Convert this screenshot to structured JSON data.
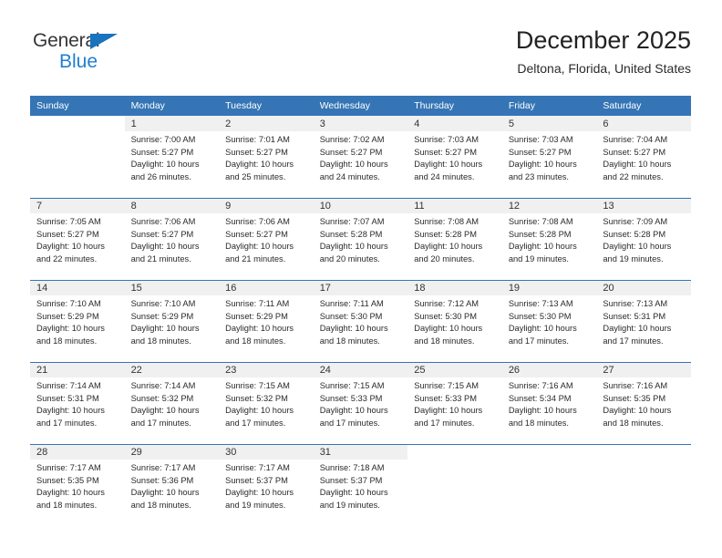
{
  "brand": {
    "name_top": "General",
    "name_bottom": "Blue",
    "triangle_color": "#1973bd",
    "text_color": "#363636",
    "blue_color": "#1f7fd1"
  },
  "header": {
    "title": "December 2025",
    "subtitle": "Deltona, Florida, United States"
  },
  "theme": {
    "header_blue": "#3575b5",
    "daynum_background": "#f0f0f0",
    "row_separator": "#3575b5"
  },
  "calendar": {
    "weekday_headers": [
      "Sunday",
      "Monday",
      "Tuesday",
      "Wednesday",
      "Thursday",
      "Friday",
      "Saturday"
    ],
    "weeks": [
      [
        {
          "day": "",
          "sunrise": "",
          "sunset": "",
          "daylight_a": "",
          "daylight_b": ""
        },
        {
          "day": "1",
          "sunrise": "Sunrise: 7:00 AM",
          "sunset": "Sunset: 5:27 PM",
          "daylight_a": "Daylight: 10 hours",
          "daylight_b": "and 26 minutes."
        },
        {
          "day": "2",
          "sunrise": "Sunrise: 7:01 AM",
          "sunset": "Sunset: 5:27 PM",
          "daylight_a": "Daylight: 10 hours",
          "daylight_b": "and 25 minutes."
        },
        {
          "day": "3",
          "sunrise": "Sunrise: 7:02 AM",
          "sunset": "Sunset: 5:27 PM",
          "daylight_a": "Daylight: 10 hours",
          "daylight_b": "and 24 minutes."
        },
        {
          "day": "4",
          "sunrise": "Sunrise: 7:03 AM",
          "sunset": "Sunset: 5:27 PM",
          "daylight_a": "Daylight: 10 hours",
          "daylight_b": "and 24 minutes."
        },
        {
          "day": "5",
          "sunrise": "Sunrise: 7:03 AM",
          "sunset": "Sunset: 5:27 PM",
          "daylight_a": "Daylight: 10 hours",
          "daylight_b": "and 23 minutes."
        },
        {
          "day": "6",
          "sunrise": "Sunrise: 7:04 AM",
          "sunset": "Sunset: 5:27 PM",
          "daylight_a": "Daylight: 10 hours",
          "daylight_b": "and 22 minutes."
        }
      ],
      [
        {
          "day": "7",
          "sunrise": "Sunrise: 7:05 AM",
          "sunset": "Sunset: 5:27 PM",
          "daylight_a": "Daylight: 10 hours",
          "daylight_b": "and 22 minutes."
        },
        {
          "day": "8",
          "sunrise": "Sunrise: 7:06 AM",
          "sunset": "Sunset: 5:27 PM",
          "daylight_a": "Daylight: 10 hours",
          "daylight_b": "and 21 minutes."
        },
        {
          "day": "9",
          "sunrise": "Sunrise: 7:06 AM",
          "sunset": "Sunset: 5:27 PM",
          "daylight_a": "Daylight: 10 hours",
          "daylight_b": "and 21 minutes."
        },
        {
          "day": "10",
          "sunrise": "Sunrise: 7:07 AM",
          "sunset": "Sunset: 5:28 PM",
          "daylight_a": "Daylight: 10 hours",
          "daylight_b": "and 20 minutes."
        },
        {
          "day": "11",
          "sunrise": "Sunrise: 7:08 AM",
          "sunset": "Sunset: 5:28 PM",
          "daylight_a": "Daylight: 10 hours",
          "daylight_b": "and 20 minutes."
        },
        {
          "day": "12",
          "sunrise": "Sunrise: 7:08 AM",
          "sunset": "Sunset: 5:28 PM",
          "daylight_a": "Daylight: 10 hours",
          "daylight_b": "and 19 minutes."
        },
        {
          "day": "13",
          "sunrise": "Sunrise: 7:09 AM",
          "sunset": "Sunset: 5:28 PM",
          "daylight_a": "Daylight: 10 hours",
          "daylight_b": "and 19 minutes."
        }
      ],
      [
        {
          "day": "14",
          "sunrise": "Sunrise: 7:10 AM",
          "sunset": "Sunset: 5:29 PM",
          "daylight_a": "Daylight: 10 hours",
          "daylight_b": "and 18 minutes."
        },
        {
          "day": "15",
          "sunrise": "Sunrise: 7:10 AM",
          "sunset": "Sunset: 5:29 PM",
          "daylight_a": "Daylight: 10 hours",
          "daylight_b": "and 18 minutes."
        },
        {
          "day": "16",
          "sunrise": "Sunrise: 7:11 AM",
          "sunset": "Sunset: 5:29 PM",
          "daylight_a": "Daylight: 10 hours",
          "daylight_b": "and 18 minutes."
        },
        {
          "day": "17",
          "sunrise": "Sunrise: 7:11 AM",
          "sunset": "Sunset: 5:30 PM",
          "daylight_a": "Daylight: 10 hours",
          "daylight_b": "and 18 minutes."
        },
        {
          "day": "18",
          "sunrise": "Sunrise: 7:12 AM",
          "sunset": "Sunset: 5:30 PM",
          "daylight_a": "Daylight: 10 hours",
          "daylight_b": "and 18 minutes."
        },
        {
          "day": "19",
          "sunrise": "Sunrise: 7:13 AM",
          "sunset": "Sunset: 5:30 PM",
          "daylight_a": "Daylight: 10 hours",
          "daylight_b": "and 17 minutes."
        },
        {
          "day": "20",
          "sunrise": "Sunrise: 7:13 AM",
          "sunset": "Sunset: 5:31 PM",
          "daylight_a": "Daylight: 10 hours",
          "daylight_b": "and 17 minutes."
        }
      ],
      [
        {
          "day": "21",
          "sunrise": "Sunrise: 7:14 AM",
          "sunset": "Sunset: 5:31 PM",
          "daylight_a": "Daylight: 10 hours",
          "daylight_b": "and 17 minutes."
        },
        {
          "day": "22",
          "sunrise": "Sunrise: 7:14 AM",
          "sunset": "Sunset: 5:32 PM",
          "daylight_a": "Daylight: 10 hours",
          "daylight_b": "and 17 minutes."
        },
        {
          "day": "23",
          "sunrise": "Sunrise: 7:15 AM",
          "sunset": "Sunset: 5:32 PM",
          "daylight_a": "Daylight: 10 hours",
          "daylight_b": "and 17 minutes."
        },
        {
          "day": "24",
          "sunrise": "Sunrise: 7:15 AM",
          "sunset": "Sunset: 5:33 PM",
          "daylight_a": "Daylight: 10 hours",
          "daylight_b": "and 17 minutes."
        },
        {
          "day": "25",
          "sunrise": "Sunrise: 7:15 AM",
          "sunset": "Sunset: 5:33 PM",
          "daylight_a": "Daylight: 10 hours",
          "daylight_b": "and 17 minutes."
        },
        {
          "day": "26",
          "sunrise": "Sunrise: 7:16 AM",
          "sunset": "Sunset: 5:34 PM",
          "daylight_a": "Daylight: 10 hours",
          "daylight_b": "and 18 minutes."
        },
        {
          "day": "27",
          "sunrise": "Sunrise: 7:16 AM",
          "sunset": "Sunset: 5:35 PM",
          "daylight_a": "Daylight: 10 hours",
          "daylight_b": "and 18 minutes."
        }
      ],
      [
        {
          "day": "28",
          "sunrise": "Sunrise: 7:17 AM",
          "sunset": "Sunset: 5:35 PM",
          "daylight_a": "Daylight: 10 hours",
          "daylight_b": "and 18 minutes."
        },
        {
          "day": "29",
          "sunrise": "Sunrise: 7:17 AM",
          "sunset": "Sunset: 5:36 PM",
          "daylight_a": "Daylight: 10 hours",
          "daylight_b": "and 18 minutes."
        },
        {
          "day": "30",
          "sunrise": "Sunrise: 7:17 AM",
          "sunset": "Sunset: 5:37 PM",
          "daylight_a": "Daylight: 10 hours",
          "daylight_b": "and 19 minutes."
        },
        {
          "day": "31",
          "sunrise": "Sunrise: 7:18 AM",
          "sunset": "Sunset: 5:37 PM",
          "daylight_a": "Daylight: 10 hours",
          "daylight_b": "and 19 minutes."
        },
        {
          "day": "",
          "sunrise": "",
          "sunset": "",
          "daylight_a": "",
          "daylight_b": ""
        },
        {
          "day": "",
          "sunrise": "",
          "sunset": "",
          "daylight_a": "",
          "daylight_b": ""
        },
        {
          "day": "",
          "sunrise": "",
          "sunset": "",
          "daylight_a": "",
          "daylight_b": ""
        }
      ]
    ]
  }
}
